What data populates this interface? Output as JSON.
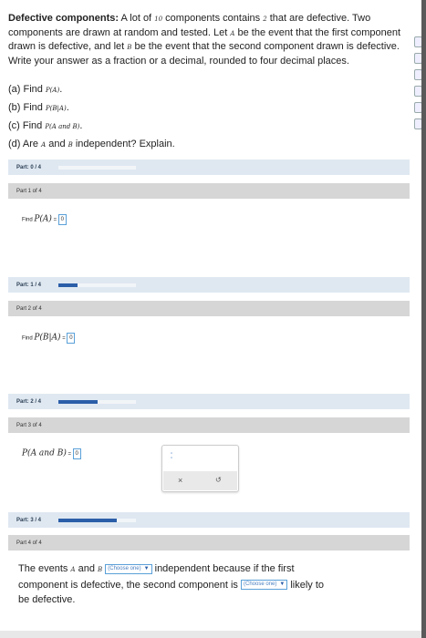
{
  "problem": {
    "title": "Defective components:",
    "s1": "A lot of",
    "n_total": "10",
    "s2": "components contains",
    "n_def": "2",
    "s3": "that are defective. Two components are drawn at random and tested. Let",
    "evA": "A",
    "s4": "be the event that the first component drawn is defective, and let",
    "evB": "B",
    "s5": "be the event that the second component drawn is defective. Write your answer as a fraction or a decimal, rounded to four decimal places."
  },
  "questions": [
    {
      "label": "(a) Find",
      "expr": "P(A)",
      "tail": "."
    },
    {
      "label": "(b) Find",
      "expr": "P(B|A)",
      "tail": "."
    },
    {
      "label": "(c) Find",
      "expr": "P(A and B)",
      "tail": "."
    },
    {
      "label": "(d) Are",
      "expr": "A",
      "mid": "and",
      "expr2": "B",
      "tail": "independent? Explain."
    }
  ],
  "parts": [
    {
      "progress_label": "Part: 0 / 4",
      "progress": 0.0,
      "sub": "Part 1 of 4",
      "find": "Find",
      "expr": "P(A)",
      "answer": "0"
    },
    {
      "progress_label": "Part: 1 / 4",
      "progress": 0.25,
      "sub": "Part 2 of 4",
      "find": "Find",
      "expr": "P(B|A)",
      "answer": "0"
    },
    {
      "progress_label": "Part: 2 / 4",
      "progress": 0.5,
      "sub": "Part 3 of 4",
      "find": "",
      "expr": "P(A and B)",
      "answer": "0"
    },
    {
      "progress_label": "Part: 3 / 4",
      "progress": 0.75,
      "sub": "Part 4 of 4"
    }
  ],
  "palette": {
    "close": "×",
    "undo": "↺"
  },
  "part4": {
    "t1": "The events",
    "a": "A",
    "and": "and",
    "b": "B",
    "choose1": "(Choose one)",
    "t2": "independent because if the first component is defective, the second component is",
    "choose2": "(Choose one)",
    "t3": "likely to be defective."
  },
  "colors": {
    "accent": "#2b5ea8",
    "input_border": "#5aa0d8",
    "section_bg": "#dfe8f1"
  }
}
